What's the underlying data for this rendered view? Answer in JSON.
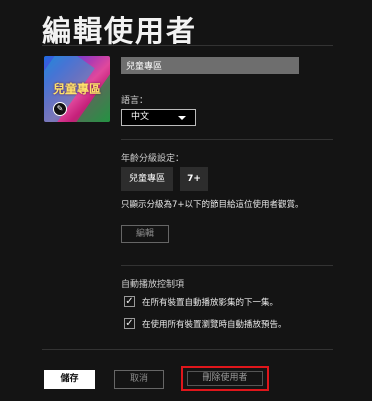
{
  "page_title": "編輯使用者",
  "avatar": {
    "text": "兒童專區",
    "edit_icon": "pencil-icon"
  },
  "profile_name": {
    "value": "兒童專區"
  },
  "language": {
    "label": "語言：",
    "selected": "中文"
  },
  "maturity": {
    "label": "年齡分級設定：",
    "badge_name": "兒童專區",
    "badge_rating": "7+",
    "description": "只顯示分級為7+以下的節目給這位使用者觀賞。",
    "edit_label": "編輯"
  },
  "autoplay": {
    "label": "自動播放控制項",
    "options": [
      {
        "label": "在所有裝置自動播放影集的下一集。",
        "checked": true
      },
      {
        "label": "在使用所有裝置瀏覽時自動播放預告。",
        "checked": true
      }
    ]
  },
  "actions": {
    "save": "儲存",
    "cancel": "取消",
    "delete": "刪除使用者"
  },
  "colors": {
    "background": "#141414",
    "highlight": "#e0161b"
  }
}
